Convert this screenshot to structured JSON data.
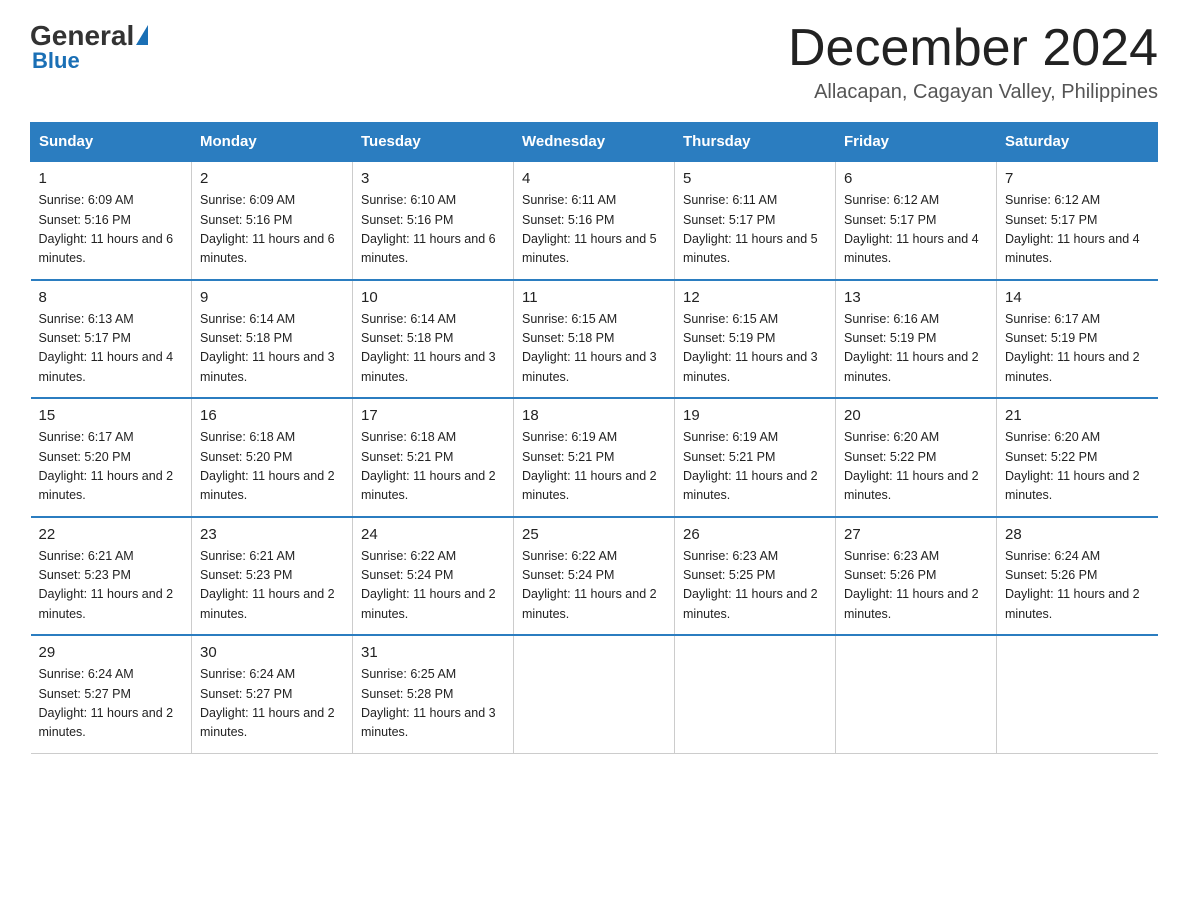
{
  "header": {
    "logo_general": "General",
    "logo_blue": "Blue",
    "month_year": "December 2024",
    "location": "Allacapan, Cagayan Valley, Philippines"
  },
  "days_of_week": [
    "Sunday",
    "Monday",
    "Tuesday",
    "Wednesday",
    "Thursday",
    "Friday",
    "Saturday"
  ],
  "weeks": [
    [
      {
        "day": "1",
        "sunrise": "6:09 AM",
        "sunset": "5:16 PM",
        "daylight": "11 hours and 6 minutes."
      },
      {
        "day": "2",
        "sunrise": "6:09 AM",
        "sunset": "5:16 PM",
        "daylight": "11 hours and 6 minutes."
      },
      {
        "day": "3",
        "sunrise": "6:10 AM",
        "sunset": "5:16 PM",
        "daylight": "11 hours and 6 minutes."
      },
      {
        "day": "4",
        "sunrise": "6:11 AM",
        "sunset": "5:16 PM",
        "daylight": "11 hours and 5 minutes."
      },
      {
        "day": "5",
        "sunrise": "6:11 AM",
        "sunset": "5:17 PM",
        "daylight": "11 hours and 5 minutes."
      },
      {
        "day": "6",
        "sunrise": "6:12 AM",
        "sunset": "5:17 PM",
        "daylight": "11 hours and 4 minutes."
      },
      {
        "day": "7",
        "sunrise": "6:12 AM",
        "sunset": "5:17 PM",
        "daylight": "11 hours and 4 minutes."
      }
    ],
    [
      {
        "day": "8",
        "sunrise": "6:13 AM",
        "sunset": "5:17 PM",
        "daylight": "11 hours and 4 minutes."
      },
      {
        "day": "9",
        "sunrise": "6:14 AM",
        "sunset": "5:18 PM",
        "daylight": "11 hours and 3 minutes."
      },
      {
        "day": "10",
        "sunrise": "6:14 AM",
        "sunset": "5:18 PM",
        "daylight": "11 hours and 3 minutes."
      },
      {
        "day": "11",
        "sunrise": "6:15 AM",
        "sunset": "5:18 PM",
        "daylight": "11 hours and 3 minutes."
      },
      {
        "day": "12",
        "sunrise": "6:15 AM",
        "sunset": "5:19 PM",
        "daylight": "11 hours and 3 minutes."
      },
      {
        "day": "13",
        "sunrise": "6:16 AM",
        "sunset": "5:19 PM",
        "daylight": "11 hours and 2 minutes."
      },
      {
        "day": "14",
        "sunrise": "6:17 AM",
        "sunset": "5:19 PM",
        "daylight": "11 hours and 2 minutes."
      }
    ],
    [
      {
        "day": "15",
        "sunrise": "6:17 AM",
        "sunset": "5:20 PM",
        "daylight": "11 hours and 2 minutes."
      },
      {
        "day": "16",
        "sunrise": "6:18 AM",
        "sunset": "5:20 PM",
        "daylight": "11 hours and 2 minutes."
      },
      {
        "day": "17",
        "sunrise": "6:18 AM",
        "sunset": "5:21 PM",
        "daylight": "11 hours and 2 minutes."
      },
      {
        "day": "18",
        "sunrise": "6:19 AM",
        "sunset": "5:21 PM",
        "daylight": "11 hours and 2 minutes."
      },
      {
        "day": "19",
        "sunrise": "6:19 AM",
        "sunset": "5:21 PM",
        "daylight": "11 hours and 2 minutes."
      },
      {
        "day": "20",
        "sunrise": "6:20 AM",
        "sunset": "5:22 PM",
        "daylight": "11 hours and 2 minutes."
      },
      {
        "day": "21",
        "sunrise": "6:20 AM",
        "sunset": "5:22 PM",
        "daylight": "11 hours and 2 minutes."
      }
    ],
    [
      {
        "day": "22",
        "sunrise": "6:21 AM",
        "sunset": "5:23 PM",
        "daylight": "11 hours and 2 minutes."
      },
      {
        "day": "23",
        "sunrise": "6:21 AM",
        "sunset": "5:23 PM",
        "daylight": "11 hours and 2 minutes."
      },
      {
        "day": "24",
        "sunrise": "6:22 AM",
        "sunset": "5:24 PM",
        "daylight": "11 hours and 2 minutes."
      },
      {
        "day": "25",
        "sunrise": "6:22 AM",
        "sunset": "5:24 PM",
        "daylight": "11 hours and 2 minutes."
      },
      {
        "day": "26",
        "sunrise": "6:23 AM",
        "sunset": "5:25 PM",
        "daylight": "11 hours and 2 minutes."
      },
      {
        "day": "27",
        "sunrise": "6:23 AM",
        "sunset": "5:26 PM",
        "daylight": "11 hours and 2 minutes."
      },
      {
        "day": "28",
        "sunrise": "6:24 AM",
        "sunset": "5:26 PM",
        "daylight": "11 hours and 2 minutes."
      }
    ],
    [
      {
        "day": "29",
        "sunrise": "6:24 AM",
        "sunset": "5:27 PM",
        "daylight": "11 hours and 2 minutes."
      },
      {
        "day": "30",
        "sunrise": "6:24 AM",
        "sunset": "5:27 PM",
        "daylight": "11 hours and 2 minutes."
      },
      {
        "day": "31",
        "sunrise": "6:25 AM",
        "sunset": "5:28 PM",
        "daylight": "11 hours and 3 minutes."
      },
      null,
      null,
      null,
      null
    ]
  ]
}
